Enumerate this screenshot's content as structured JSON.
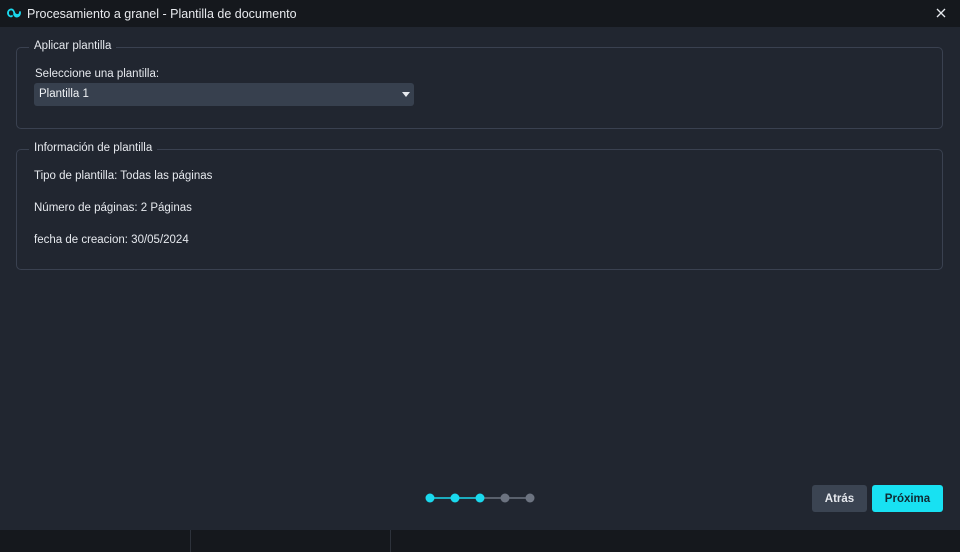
{
  "window": {
    "title": "Procesamiento a granel - Plantilla de documento",
    "app_icon": "sync-loop-icon",
    "close_icon": "close-icon"
  },
  "apply_template": {
    "legend": "Aplicar plantilla",
    "select_label": "Seleccione una plantilla:",
    "selected_value": "Plantilla 1"
  },
  "template_info": {
    "legend": "Información de plantilla",
    "type_line": "Tipo de plantilla: Todas las páginas",
    "pages_line": "Número de páginas: 2 Páginas",
    "date_line": "fecha de creacion: 30/05/2024"
  },
  "wizard": {
    "total_steps": 5,
    "completed_steps": 3,
    "active_color": "#1ad9ee",
    "inactive_color": "#6c7380"
  },
  "buttons": {
    "back_label": "Atrás",
    "next_label": "Próxima"
  },
  "colors": {
    "accent": "#18e1f2",
    "background": "#212630",
    "titlebar": "#15181d"
  }
}
